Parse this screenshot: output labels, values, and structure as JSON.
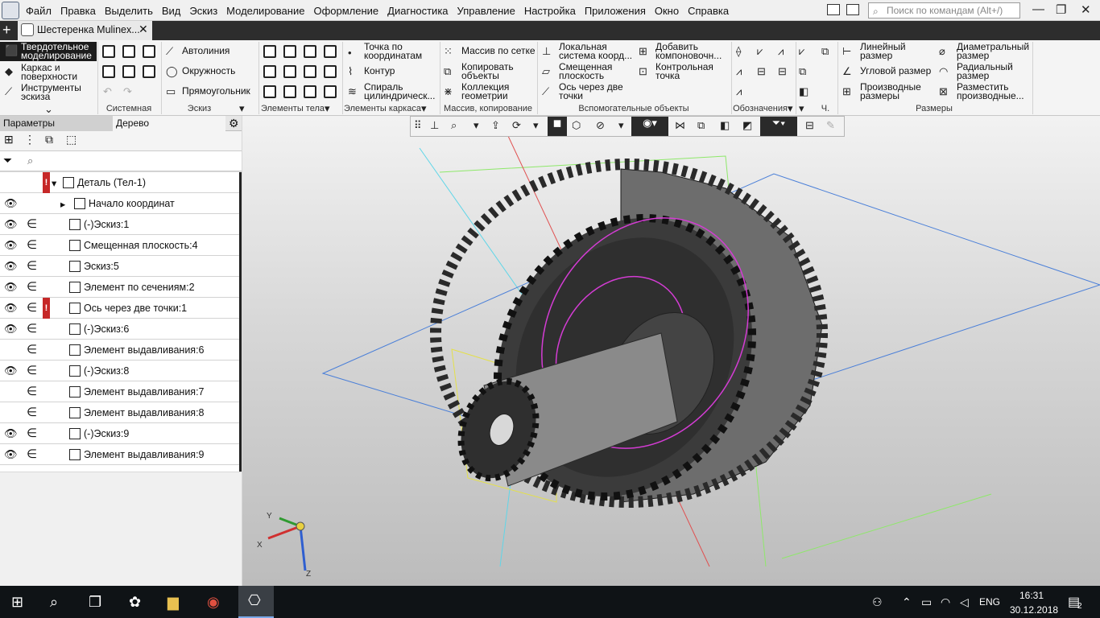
{
  "menu": {
    "items": [
      "Файл",
      "Правка",
      "Выделить",
      "Вид",
      "Эскиз",
      "Моделирование",
      "Оформление",
      "Диагностика",
      "Управление",
      "Настройка",
      "Приложения",
      "Окно",
      "Справка"
    ],
    "search_placeholder": "Поиск по командам (Alt+/)"
  },
  "tab": {
    "title": "Шестеренка Mulinex..."
  },
  "ribbon": {
    "mode": [
      "Твердотельное\nмоделирование",
      "Каркас и\nповерхности",
      "Инструменты\nэскиза"
    ],
    "sketch": [
      "Автолиния",
      "Окружность",
      "Прямоугольник"
    ],
    "frame": [
      "Точка по\nкоординатам",
      "Контур",
      "Спираль\nцилиндрическ..."
    ],
    "array": [
      "Массив по сетке",
      "Копировать\nобъекты",
      "Коллекция\nгеометрии"
    ],
    "aux1": [
      "Локальная\nсистема коорд...",
      "Смещенная\nплоскость",
      "Ось через две\nточки"
    ],
    "aux2": [
      "Добавить\nкомпоновочн...",
      "Контрольная\nточка"
    ],
    "dims1": [
      "Линейный\nразмер",
      "Угловой размер",
      "Производные\nразмеры"
    ],
    "dims2": [
      "Диаметральный\nразмер",
      "Радиальный\nразмер",
      "Разместить\nпроизводные..."
    ],
    "groups": [
      "Системная",
      "Эскиз",
      "Элементы тела",
      "Элементы каркаса",
      "Массив, копирование",
      "Вспомогательные объекты",
      "Обозначения",
      "Ч.",
      "Размеры"
    ]
  },
  "panel": {
    "tab_params": "Параметры",
    "tab_tree": "Дерево",
    "rows": [
      {
        "label": "Деталь (Тел-1)",
        "eye": false,
        "rel": false,
        "warn": true
      },
      {
        "label": "Начало координат",
        "eye": true,
        "rel": false,
        "warn": false
      },
      {
        "label": "(-)Эскиз:1",
        "eye": true,
        "rel": true,
        "warn": false
      },
      {
        "label": "Смещенная плоскость:4",
        "eye": true,
        "rel": true,
        "warn": false
      },
      {
        "label": "Эскиз:5",
        "eye": true,
        "rel": true,
        "warn": false
      },
      {
        "label": "Элемент по сечениям:2",
        "eye": true,
        "rel": true,
        "warn": false
      },
      {
        "label": "Ось через две точки:1",
        "eye": true,
        "rel": true,
        "warn": true
      },
      {
        "label": "(-)Эскиз:6",
        "eye": true,
        "rel": true,
        "warn": false
      },
      {
        "label": "Элемент выдавливания:6",
        "eye": false,
        "rel": true,
        "warn": false
      },
      {
        "label": "(-)Эскиз:8",
        "eye": true,
        "rel": true,
        "warn": false
      },
      {
        "label": "Элемент выдавливания:7",
        "eye": false,
        "rel": true,
        "warn": false
      },
      {
        "label": "Элемент выдавливания:8",
        "eye": false,
        "rel": true,
        "warn": false
      },
      {
        "label": "(-)Эскиз:9",
        "eye": true,
        "rel": true,
        "warn": false
      },
      {
        "label": "Элемент выдавливания:9",
        "eye": true,
        "rel": true,
        "warn": false
      }
    ]
  },
  "axes": {
    "x": "X",
    "y": "Y",
    "z": "Z"
  },
  "taskbar": {
    "lang": "ENG",
    "time": "16:31",
    "date": "30.12.2018",
    "notif": "2"
  }
}
